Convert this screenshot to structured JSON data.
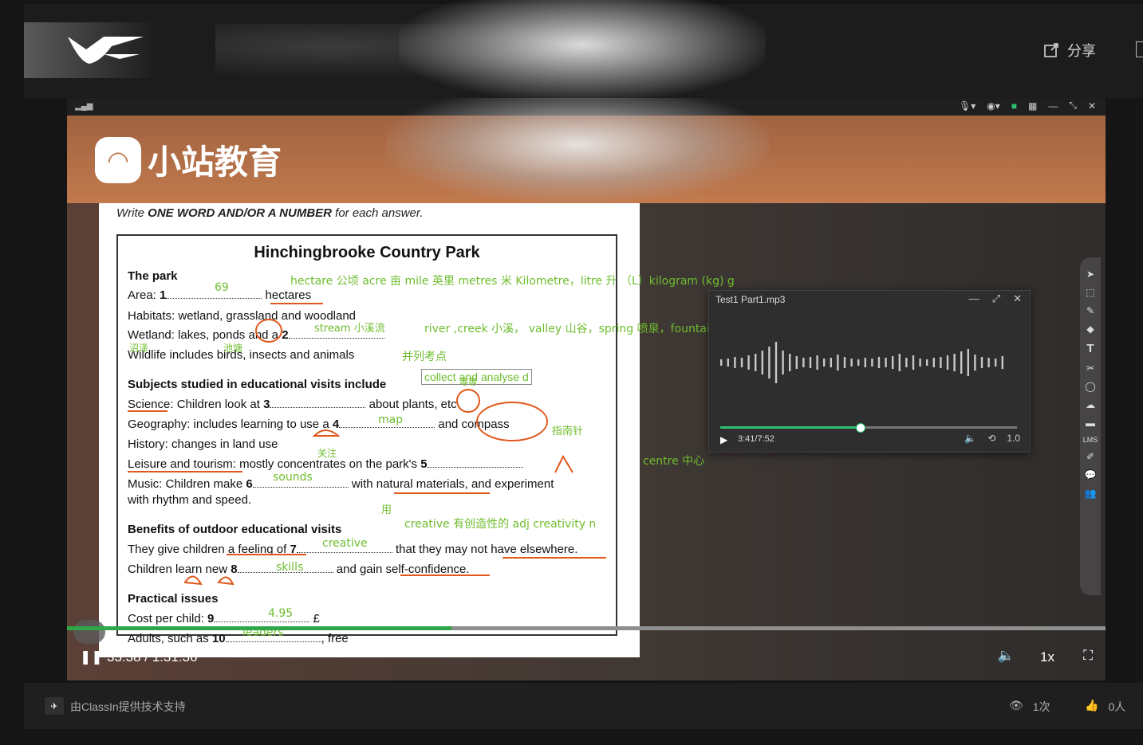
{
  "header": {
    "share_label": "分享"
  },
  "window": {
    "signal_icon": "signal-bars-icon"
  },
  "brand": {
    "name": "小站教育"
  },
  "document": {
    "instruction_prefix": "Write",
    "instruction_bold": "ONE WORD AND/OR A NUMBER",
    "instruction_suffix": "for each answer.",
    "title": "Hinchingbrooke Country Park",
    "lines": [
      {
        "a": "The park",
        "b": "",
        "c": "",
        "bold": true
      },
      {
        "a": "Area: ",
        "b": "1",
        "c": " hectares"
      },
      {
        "a": "Habitats: wetland, grassland and woodland",
        "b": "",
        "c": ""
      },
      {
        "a": "Wetland: lakes, ponds and a ",
        "b": "2",
        "c": ""
      },
      {
        "a": "Wildlife includes birds, insects and animals",
        "b": "",
        "c": ""
      },
      {
        "a": "Subjects studied in educational visits include",
        "b": "",
        "c": "",
        "bold": true
      },
      {
        "a": "Science: Children look at ",
        "b": "3",
        "c": " about plants, etc"
      },
      {
        "a": "Geography: includes learning to use a ",
        "b": "4",
        "c": " and compass"
      },
      {
        "a": "History: changes in land use",
        "b": "",
        "c": ""
      },
      {
        "a": "Leisure and tourism: mostly concentrates on the park's ",
        "b": "5",
        "c": ""
      },
      {
        "a": "Music: Children make ",
        "b": "6",
        "c": " with natural materials, and experiment"
      },
      {
        "a": "with rhythm and speed.",
        "b": "",
        "c": ""
      },
      {
        "a": "Benefits of outdoor educational visits",
        "b": "",
        "c": "",
        "bold": true
      },
      {
        "a": "They give children a feeling of ",
        "b": "7",
        "c": " that they may not have elsewhere."
      },
      {
        "a": "Children learn new ",
        "b": "8",
        "c": " and gain self-confidence."
      },
      {
        "a": "Practical issues",
        "b": "",
        "c": "",
        "bold": true
      },
      {
        "a": "Cost per child: ",
        "b": "9",
        "c": " £"
      },
      {
        "a": "Adults, such as ",
        "b": "10",
        "c": ", free"
      }
    ]
  },
  "annotations": {
    "a69": "69",
    "units": "hectare 公顷  acre 亩  mile 英里  metres 米 Kilometre，litre 升 （L）kilogram (kg)  g",
    "stream": "stream 小溪流",
    "river": "river ,creek 小溪， valley 山谷，spring 喷泉，fountain",
    "marsh": "沼泽",
    "pond": "池塘",
    "parallel": "并列考点",
    "collect": "collect and analyse d",
    "etc": "等等",
    "map": "map",
    "compass_cn": "指南针",
    "focus": "关注",
    "sounds": "sounds",
    "use": "用",
    "creative_def": "creative 有创造性的 adj creativity n",
    "creative": "creative",
    "skills": "skills",
    "cost": "4.95",
    "leaders": "leaders",
    "centre": "centre 中心"
  },
  "player": {
    "title": "Test1 Part1.mp3",
    "time": "3:41/7:52",
    "speed": "1.0",
    "progress_fraction": 0.47
  },
  "video": {
    "time": "33:38 / 1:31:36",
    "speed": "1x",
    "progress_fraction": 0.37
  },
  "footer": {
    "credit": "由ClassIn提供技术支持",
    "views": "1次",
    "likes": "0人"
  },
  "colors": {
    "annotation": "#6fbd2e",
    "underline": "#e2571a",
    "progress": "#2ea64a"
  }
}
